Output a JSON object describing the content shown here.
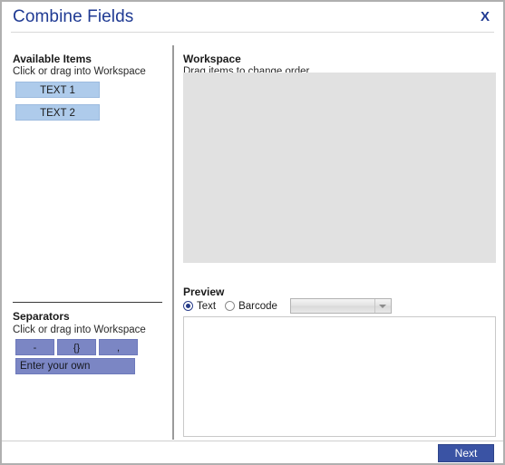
{
  "window": {
    "title": "Combine Fields",
    "close_label": "X"
  },
  "available": {
    "title": "Available Items",
    "subtitle": "Click or drag into Workspace",
    "items": [
      {
        "label": "TEXT 1"
      },
      {
        "label": "TEXT 2"
      }
    ]
  },
  "separators": {
    "title": "Separators",
    "subtitle": "Click or drag into Workspace",
    "buttons": [
      {
        "label": "-"
      },
      {
        "label": "{}"
      },
      {
        "label": ","
      }
    ],
    "custom": {
      "value": "Enter your own",
      "placeholder": "Enter your own"
    }
  },
  "workspace": {
    "title": "Workspace",
    "subtitle": "Drag items to change order",
    "content": ""
  },
  "preview": {
    "title": "Preview",
    "mode_options": [
      {
        "label": "Text",
        "selected": true
      },
      {
        "label": "Barcode",
        "selected": false
      }
    ],
    "barcode_select": {
      "value": "",
      "placeholder": ""
    },
    "text": ""
  },
  "footer": {
    "next_label": "Next"
  },
  "colors": {
    "title_blue": "#1f3a93",
    "field_item": "#aecbeb",
    "separator": "#7b86c4",
    "workspace_bg": "#e1e1e1",
    "primary_button": "#3a53a4"
  }
}
